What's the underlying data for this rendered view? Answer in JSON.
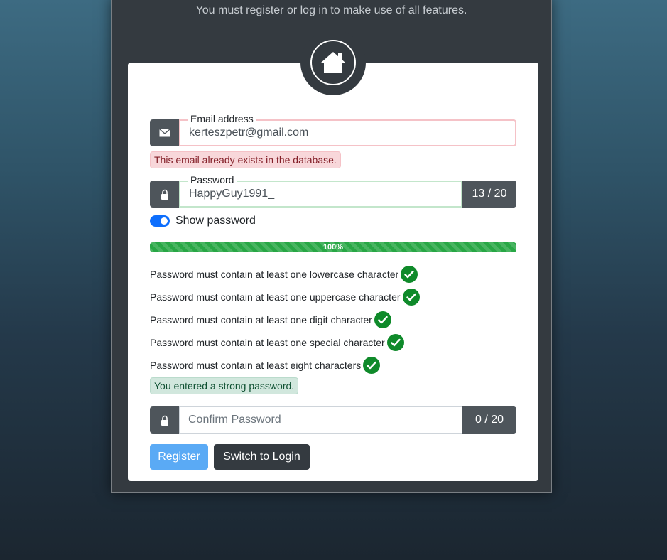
{
  "header": {
    "intro_text": "You must register or log in to make use of all features."
  },
  "form": {
    "email": {
      "label": "Email address",
      "value": "kerteszpetr@gmail.com",
      "error": "This email already exists in the database."
    },
    "password": {
      "label": "Password",
      "value": "HappyGuy1991_",
      "counter": "13 / 20"
    },
    "show_password": {
      "label": "Show password",
      "checked": true
    },
    "strength": {
      "percent": 100,
      "label": "100%"
    },
    "rules": [
      "Password must contain at least one lowercase character",
      "Password must contain at least one uppercase character",
      "Password must contain at least one digit character",
      "Password must contain at least one special character",
      "Password must contain at least eight characters"
    ],
    "strength_message": "You entered a strong password.",
    "confirm": {
      "placeholder": "Confirm Password",
      "counter": "0 / 20"
    },
    "buttons": {
      "register": "Register",
      "switch_login": "Switch to Login"
    }
  },
  "colors": {
    "accent": "#0d6efd",
    "success": "#28a745",
    "danger_bg": "#f8d7da",
    "dark": "#343a40"
  }
}
